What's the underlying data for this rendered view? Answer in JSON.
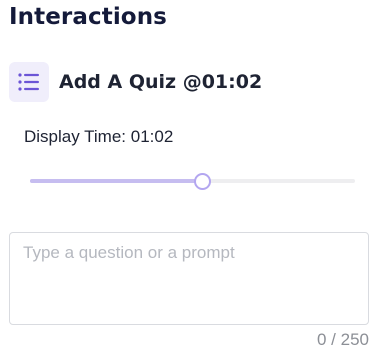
{
  "panel": {
    "title": "Interactions"
  },
  "interaction": {
    "icon": "list-icon",
    "title": "Add A Quiz @01:02"
  },
  "display_time": {
    "label": "Display Time: 01:02",
    "slider_progress": 0.53
  },
  "prompt": {
    "value": "",
    "placeholder": "Type a question or a prompt",
    "char_count": "0 / 250"
  },
  "colors": {
    "accent": "#6b55d6",
    "icon_bg": "#f0eefb",
    "slider_fill": "#c6bdf0",
    "slider_thumb_border": "#b3a6f0",
    "title_text": "#141a3a"
  }
}
